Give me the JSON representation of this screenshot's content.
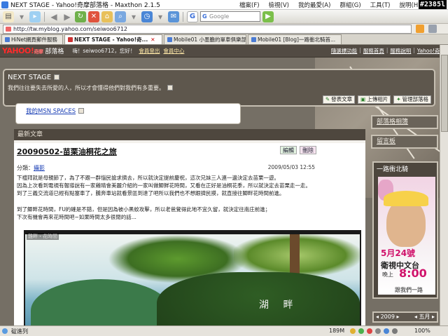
{
  "window": {
    "title": "NEXT STAGE - Yahoo!奇摩部落格 - Maxthon 2.1.5",
    "badge": "#2385l"
  },
  "menu": [
    "檔案(F)",
    "檢視(V)",
    "我的最愛(A)",
    "群組(G)",
    "工具(T)",
    "說明(H)"
  ],
  "toolbar": {
    "search_placeholder": "Google"
  },
  "address": {
    "url": "http://tw.myblog.yahoo.com/seiwoo6712"
  },
  "tabs": [
    {
      "label": "HiNet網頁郵件服務"
    },
    {
      "label": "NEXT STAGE - Yahoo!奇..."
    },
    {
      "label": "Mobile01 小墨膽的單車俱樂部"
    },
    {
      "label": "Mobile01 [Blog]一路衝北騎首..."
    }
  ],
  "yahoo_bar": {
    "logo": "YAHOO!",
    "logo_sub": "奇摩",
    "dept": "部落格",
    "greeting": "嗨！seiwoo6712，您好！",
    "links": [
      "會員登出",
      "會員中心"
    ],
    "right_links": [
      "隨選標功能",
      "服務首頁",
      "服務說明",
      "Yahoo!奇摩"
    ]
  },
  "header": {
    "title": "NEXT STAGE",
    "subtitle": "我們往往要失去所愛的人，所以才會懂得他們對我們有多重要。",
    "buttons": [
      "發表文章",
      "上傳相片",
      "管理部落格"
    ]
  },
  "msn": {
    "label": "我的MSN SPACES"
  },
  "section": {
    "title": "最新文章"
  },
  "post": {
    "title": "20090502-苗栗油桐花之旅",
    "edit_label": "編輯",
    "delete_label": "刪除",
    "category_label": "分類：",
    "category": "攝影",
    "date": "2009/05/03 12:55",
    "lines": [
      "下禮拜就是母親節了，為了不跟一群惱民搶求擠去，所以就決定提前慶祝，這次兄妹三人連一邊決定去苗栗一遊。",
      "因為上次看到電視有報導說有一家雞晴會美麗介紹的一家叫做鯽鮮花時間，又看在正好是油桐花季，所以就決定去苗栗走一走。",
      "到了三義交流道已經有點塞車了，騰奔車站就看景區到達了吧所以我們也不想跟擠民摸，就直接往鯽畔花時間前進。",
      "",
      "到了鯽畔花時間，FU的確是不錯，但是因為被小黑蚊攻擊，所以老爸覺得此地不宜久留，就決定往南庄前進；",
      "下次有機會再來花時間吧~如果時間太多很閒的話..."
    ],
    "image_caption": "雞畔・花時間",
    "image_sign": "湖 畔"
  },
  "sidebar": {
    "items": [
      "部落格相簿",
      "留言板"
    ],
    "widget_title": "一路衝北騎",
    "ad": {
      "date": "5月24號",
      "channel": "衛視中文台",
      "time_label": "晚上",
      "time": "8:00",
      "tagline": "跟我們一路"
    },
    "calendar_year": "2009",
    "calendar_month": "五月"
  },
  "status": {
    "text": "碇進列",
    "memory": "189M",
    "zoom": "100%"
  }
}
